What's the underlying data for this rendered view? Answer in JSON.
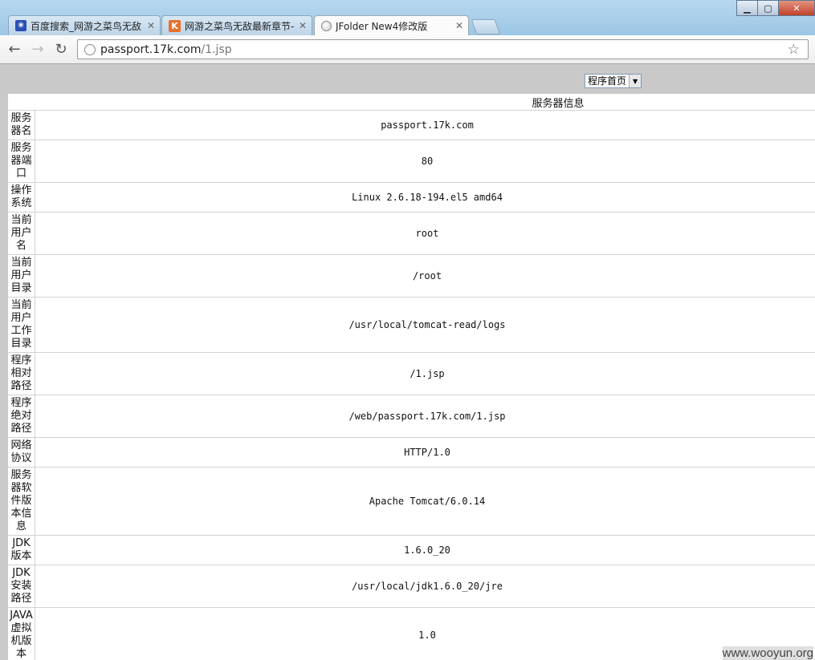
{
  "tabs": [
    {
      "title": "百度搜索_网游之菜鸟无敌",
      "icon": "baidu-paw-icon",
      "active": false
    },
    {
      "title": "网游之菜鸟无敌最新章节-!",
      "icon": "k-site-icon",
      "active": false
    },
    {
      "title": "JFolder New4修改版",
      "icon": "globe-icon",
      "active": true
    }
  ],
  "address": {
    "host": "passport.17k.com",
    "path": "/1.jsp"
  },
  "page": {
    "select_value": "程序首页",
    "caption": "服务器信息",
    "rows": [
      {
        "label": "服务器名",
        "value": "passport.17k.com"
      },
      {
        "label": "服务器端口",
        "value": "80"
      },
      {
        "label": "操作系统",
        "value": "Linux 2.6.18-194.el5 amd64"
      },
      {
        "label": "当前用户名",
        "value": "root"
      },
      {
        "label": "当前用户目录",
        "value": "/root"
      },
      {
        "label": "当前用户工作目录",
        "value": "/usr/local/tomcat-read/logs"
      },
      {
        "label": "程序相对路径",
        "value": "/1.jsp"
      },
      {
        "label": "程序绝对路径",
        "value": "/web/passport.17k.com/1.jsp"
      },
      {
        "label": "网络协议",
        "value": "HTTP/1.0"
      },
      {
        "label": "服务器软件版本信息",
        "value": "Apache Tomcat/6.0.14"
      },
      {
        "label": "JDK版本",
        "value": "1.6.0_20"
      },
      {
        "label": "JDK安装路径",
        "value": "/usr/local/jdk1.6.0_20/jre"
      },
      {
        "label": "JAVA虚拟机版本",
        "value": "1.0"
      }
    ]
  },
  "watermark": "www.wooyun.org"
}
